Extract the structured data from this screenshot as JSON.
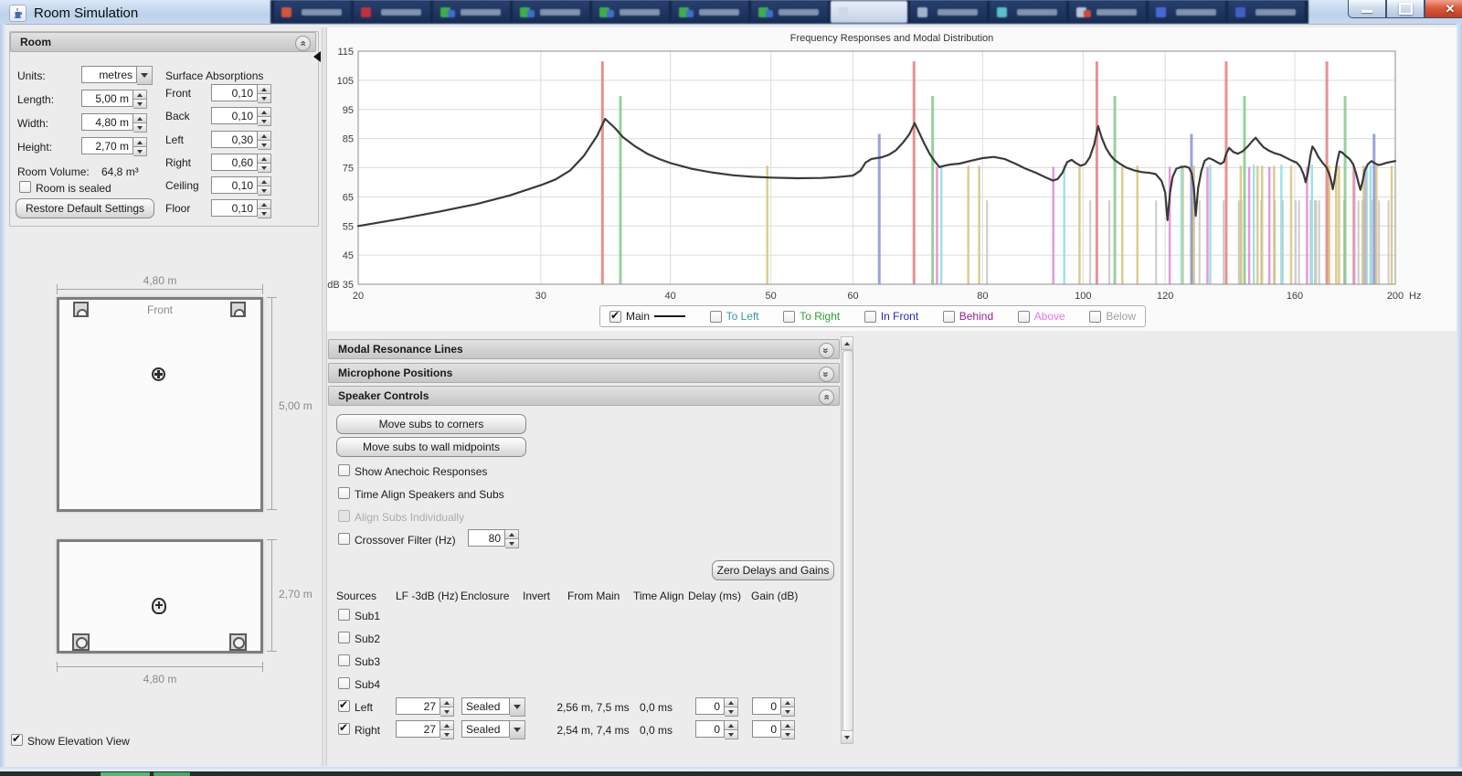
{
  "window": {
    "title": "Room Simulation"
  },
  "taskbar": {
    "buttons": [
      {
        "c1": "#d4553a"
      },
      {
        "c1": "#c03040"
      },
      {
        "c1": "#3fae49",
        "c2": "#3d6fd0"
      },
      {
        "c1": "#3fae49",
        "c2": "#3d6fd0"
      },
      {
        "c1": "#3fae49",
        "c2": "#3d6fd0"
      },
      {
        "c1": "#3fae49",
        "c2": "#3d6fd0"
      },
      {
        "c1": "#3fae49",
        "c2": "#3d6fd0"
      },
      {
        "c1": "#cfd8e8",
        "active": true
      },
      {
        "c1": "#9fb2cc"
      },
      {
        "c1": "#58c0c8"
      },
      {
        "c1": "#b8c4d8",
        "c2": "#d04838"
      },
      {
        "c1": "#4868d8"
      },
      {
        "c1": "#4060c8"
      }
    ],
    "bottom_greens": [
      "#58b878",
      "#48a868"
    ]
  },
  "room_panel": {
    "title": "Room",
    "units_label": "Units:",
    "units_value": "metres",
    "length_label": "Length:",
    "length_value": "5,00 m",
    "width_label": "Width:",
    "width_value": "4,80 m",
    "height_label": "Height:",
    "height_value": "2,70 m",
    "volume_label": "Room Volume:",
    "volume_value": "64,8 m³",
    "sealed_label": "Room is sealed",
    "sealed_checked": false,
    "restore_button": "Restore Default Settings",
    "surface_title": "Surface Absorptions",
    "surfaces": [
      {
        "label": "Front",
        "value": "0,10"
      },
      {
        "label": "Back",
        "value": "0,10"
      },
      {
        "label": "Left",
        "value": "0,30"
      },
      {
        "label": "Right",
        "value": "0,60"
      },
      {
        "label": "Ceiling",
        "value": "0,10"
      },
      {
        "label": "Floor",
        "value": "0,10"
      }
    ]
  },
  "diagrams": {
    "plan": {
      "front_label": "Front",
      "width_dim": "4,80 m",
      "length_dim": "5,00 m"
    },
    "elevation": {
      "height_dim": "2,70 m",
      "width_dim": "4,80 m"
    },
    "show_elevation_label": "Show Elevation View",
    "show_elevation_checked": true
  },
  "panels": {
    "modal_resonance": "Modal Resonance Lines",
    "microphone_positions": "Microphone Positions",
    "speaker_controls": "Speaker Controls"
  },
  "speaker_controls": {
    "move_corners": "Move subs to corners",
    "move_midpoints": "Move subs to wall midpoints",
    "show_anechoic": "Show Anechoic Responses",
    "show_anechoic_checked": false,
    "time_align": "Time Align Speakers and Subs",
    "time_align_checked": false,
    "align_individually": "Align Subs Individually",
    "align_individually_checked": false,
    "crossover_label": "Crossover Filter (Hz)",
    "crossover_checked": false,
    "crossover_value": "80",
    "zero_button": "Zero Delays and Gains",
    "table": {
      "headers": [
        "Sources",
        "LF -3dB (Hz)",
        "Enclosure",
        "Invert",
        "From Main",
        "Time Align",
        "Delay (ms)",
        "Gain (dB)"
      ],
      "rows": [
        {
          "label": "Sub1",
          "checked": false
        },
        {
          "label": "Sub2",
          "checked": false
        },
        {
          "label": "Sub3",
          "checked": false
        },
        {
          "label": "Sub4",
          "checked": false
        },
        {
          "label": "Left",
          "checked": true,
          "lf3db": "27",
          "enclosure": "Sealed",
          "from_main": "2,56 m, 7,5 ms",
          "time_align": "0,0 ms",
          "delay": "0",
          "gain": "0"
        },
        {
          "label": "Right",
          "checked": true,
          "lf3db": "27",
          "enclosure": "Sealed",
          "from_main": "2,54 m, 7,4 ms",
          "time_align": "0,0 ms",
          "delay": "0",
          "gain": "0"
        }
      ]
    }
  },
  "chart_data": {
    "type": "line",
    "title": "Frequency Responses and Modal Distribution",
    "x_axis": {
      "unit": "Hz",
      "scale": "log",
      "min": 20,
      "max": 200,
      "ticks": [
        20,
        30,
        40,
        50,
        60,
        80,
        100,
        120,
        160,
        200
      ]
    },
    "y_axis": {
      "unit": "dB",
      "min": 35,
      "max": 115,
      "ticks": [
        115,
        105,
        95,
        85,
        75,
        65,
        55,
        45,
        35
      ]
    },
    "grid": true,
    "legend_position": "bottom",
    "main_color": "#3a3a3a",
    "legend": [
      {
        "label": "Main",
        "checked": true,
        "color": "#1a1a1a",
        "swatch": true
      },
      {
        "label": "To Left",
        "checked": false,
        "color": "#2e9d9d"
      },
      {
        "label": "To Right",
        "checked": false,
        "color": "#2fa02f"
      },
      {
        "label": "In Front",
        "checked": false,
        "color": "#2525cc"
      },
      {
        "label": "Behind",
        "checked": false,
        "color": "#992299"
      },
      {
        "label": "Above",
        "checked": false,
        "color": "#e878e8"
      },
      {
        "label": "Below",
        "checked": false,
        "color": "#a0a0a0"
      }
    ],
    "main_response": [
      [
        20,
        55
      ],
      [
        22,
        57.5
      ],
      [
        24,
        60
      ],
      [
        26,
        62.5
      ],
      [
        28,
        65.5
      ],
      [
        30,
        69
      ],
      [
        31,
        71
      ],
      [
        32,
        74
      ],
      [
        33,
        79
      ],
      [
        34,
        86
      ],
      [
        34.6,
        91.8
      ],
      [
        35.4,
        88.5
      ],
      [
        36,
        85.5
      ],
      [
        37,
        82.3
      ],
      [
        38,
        79.8
      ],
      [
        39,
        78
      ],
      [
        40,
        76.6
      ],
      [
        42,
        74.6
      ],
      [
        44,
        73.3
      ],
      [
        46,
        72.4
      ],
      [
        48,
        71.9
      ],
      [
        50,
        71.6
      ],
      [
        53,
        71.4
      ],
      [
        56,
        71.5
      ],
      [
        58,
        71.8
      ],
      [
        60,
        72.3
      ],
      [
        61,
        74
      ],
      [
        61.7,
        76.8
      ],
      [
        62.5,
        78
      ],
      [
        64,
        78.6
      ],
      [
        65,
        79.5
      ],
      [
        66,
        81
      ],
      [
        67,
        83.5
      ],
      [
        68,
        86.5
      ],
      [
        68.8,
        90.3
      ],
      [
        69.6,
        86.5
      ],
      [
        70.4,
        82.8
      ],
      [
        71.2,
        79.5
      ],
      [
        72,
        77
      ],
      [
        72.7,
        75.2
      ],
      [
        73.5,
        75.7
      ],
      [
        74.5,
        76.1
      ],
      [
        76,
        76.4
      ],
      [
        78,
        77.4
      ],
      [
        80,
        78.3
      ],
      [
        82,
        78.7
      ],
      [
        84,
        78
      ],
      [
        86,
        76.4
      ],
      [
        88,
        74.7
      ],
      [
        90,
        73.3
      ],
      [
        92,
        71.7
      ],
      [
        93.5,
        70.6
      ],
      [
        94.5,
        71.1
      ],
      [
        95.5,
        73.2
      ],
      [
        96.5,
        76.9
      ],
      [
        97.5,
        77.7
      ],
      [
        98.5,
        76.5
      ],
      [
        99.5,
        75.7
      ],
      [
        100.5,
        76.3
      ],
      [
        101.5,
        78.6
      ],
      [
        102.5,
        83
      ],
      [
        103.4,
        89.3
      ],
      [
        104.3,
        85
      ],
      [
        105.2,
        81.8
      ],
      [
        106.2,
        79.4
      ],
      [
        107.2,
        77.7
      ],
      [
        108.5,
        76.4
      ],
      [
        110,
        75.1
      ],
      [
        112,
        74.1
      ],
      [
        114,
        73.5
      ],
      [
        116,
        73.2
      ],
      [
        117.5,
        72.8
      ],
      [
        119,
        70.5
      ],
      [
        120,
        66.5
      ],
      [
        120.6,
        57
      ],
      [
        121.3,
        66.5
      ],
      [
        122,
        71.8
      ],
      [
        123,
        74.7
      ],
      [
        124.2,
        75.2
      ],
      [
        125.5,
        75.4
      ],
      [
        126.5,
        75
      ],
      [
        127.3,
        73
      ],
      [
        127.9,
        68
      ],
      [
        128.4,
        58.5
      ],
      [
        129.1,
        68
      ],
      [
        130,
        73.8
      ],
      [
        131,
        77.4
      ],
      [
        132.2,
        78.3
      ],
      [
        133.3,
        77.8
      ],
      [
        134.5,
        77
      ],
      [
        135.7,
        76.3
      ],
      [
        136.7,
        77
      ],
      [
        137.4,
        79.8
      ],
      [
        138.3,
        81.8
      ],
      [
        139.6,
        80.4
      ],
      [
        141,
        79.8
      ],
      [
        142.6,
        80.7
      ],
      [
        144.2,
        82.4
      ],
      [
        145.7,
        84.3
      ],
      [
        146.7,
        85.3
      ],
      [
        147.8,
        83.8
      ],
      [
        149.2,
        82.1
      ],
      [
        151,
        80.9
      ],
      [
        153,
        80
      ],
      [
        155,
        79.4
      ],
      [
        157,
        78.4
      ],
      [
        159,
        77.4
      ],
      [
        160.6,
        76.8
      ],
      [
        162,
        75.3
      ],
      [
        163.2,
        72.6
      ],
      [
        163.9,
        70
      ],
      [
        164.7,
        73.2
      ],
      [
        165.6,
        79
      ],
      [
        166.4,
        82.3
      ],
      [
        167.4,
        80.9
      ],
      [
        168.6,
        78.7
      ],
      [
        170,
        76.9
      ],
      [
        171.6,
        75.2
      ],
      [
        172.7,
        72.9
      ],
      [
        173.5,
        70.4
      ],
      [
        174.1,
        67.6
      ],
      [
        174.8,
        71
      ],
      [
        175.7,
        76.6
      ],
      [
        176.7,
        80.6
      ],
      [
        177.8,
        80.2
      ],
      [
        179.2,
        79
      ],
      [
        180.7,
        78
      ],
      [
        182.2,
        76.1
      ],
      [
        183.6,
        72.2
      ],
      [
        184.4,
        69.4
      ],
      [
        185.1,
        67.4
      ],
      [
        185.9,
        70.1
      ],
      [
        186.9,
        74
      ],
      [
        188.2,
        76.2
      ],
      [
        189.7,
        77.3
      ],
      [
        191.2,
        76.5
      ],
      [
        192.7,
        75.9
      ],
      [
        194.2,
        76.2
      ],
      [
        196.2,
        76.7
      ],
      [
        198.2,
        77
      ],
      [
        200,
        77.3
      ]
    ],
    "modal_lines": [
      {
        "name": "oblique",
        "color": "#c4c4c4",
        "width": 2,
        "top_db": 63.8,
        "freqs": [
          80.8,
          101.6,
          106.0,
          117.6,
          127.4,
          129.5,
          136.6,
          141.3,
          142.1,
          148.5,
          153.1,
          155.8,
          160.3,
          161.5,
          165.7,
          167.3,
          167.8,
          168.9,
          178.5,
          178.9,
          184.3,
          185.9,
          186.6,
          189.7,
          192.9,
          197.0
        ]
      },
      {
        "name": "tangential-length-width",
        "color": "#d6c47c",
        "width": 2.5,
        "top_db": 75.7,
        "freqs": [
          49.6,
          77.5,
          79.4,
          99.2,
          109.1,
          112.8,
          124.8,
          127.9,
          141.9,
          147.3,
          148.8,
          152.8,
          158.7,
          172.7,
          175.4,
          176.5,
          182.2,
          186.4,
          191.8,
          198.4
        ]
      },
      {
        "name": "tangential-length-height",
        "color": "#e188d6",
        "width": 2.5,
        "top_db": 75.3,
        "freqs": [
          72.3,
          93.6,
          121.2,
          131.8,
          144.6,
          151.2,
          164.4,
          182.6,
          187.3
        ]
      },
      {
        "name": "tangential-width-height",
        "color": "#8edee2",
        "width": 2.5,
        "top_db": 76.0,
        "freqs": [
          73.0,
          95.9,
          124.4,
          132.6,
          146.1,
          155.3,
          166.2,
          187.7,
          189.3
        ]
      },
      {
        "name": "height-axial",
        "color": "#8b93d6",
        "width": 3,
        "top_db": 86.6,
        "freqs": [
          63.6,
          127.2,
          190.8
        ]
      },
      {
        "name": "width-axial",
        "color": "#86c98b",
        "width": 3,
        "top_db": 99.6,
        "freqs": [
          35.8,
          71.6,
          107.3,
          143.1,
          178.9
        ]
      },
      {
        "name": "length-axial",
        "color": "#e57f7f",
        "width": 3,
        "top_db": 111.5,
        "freqs": [
          34.4,
          68.7,
          103.1,
          137.4,
          171.8
        ]
      }
    ]
  }
}
